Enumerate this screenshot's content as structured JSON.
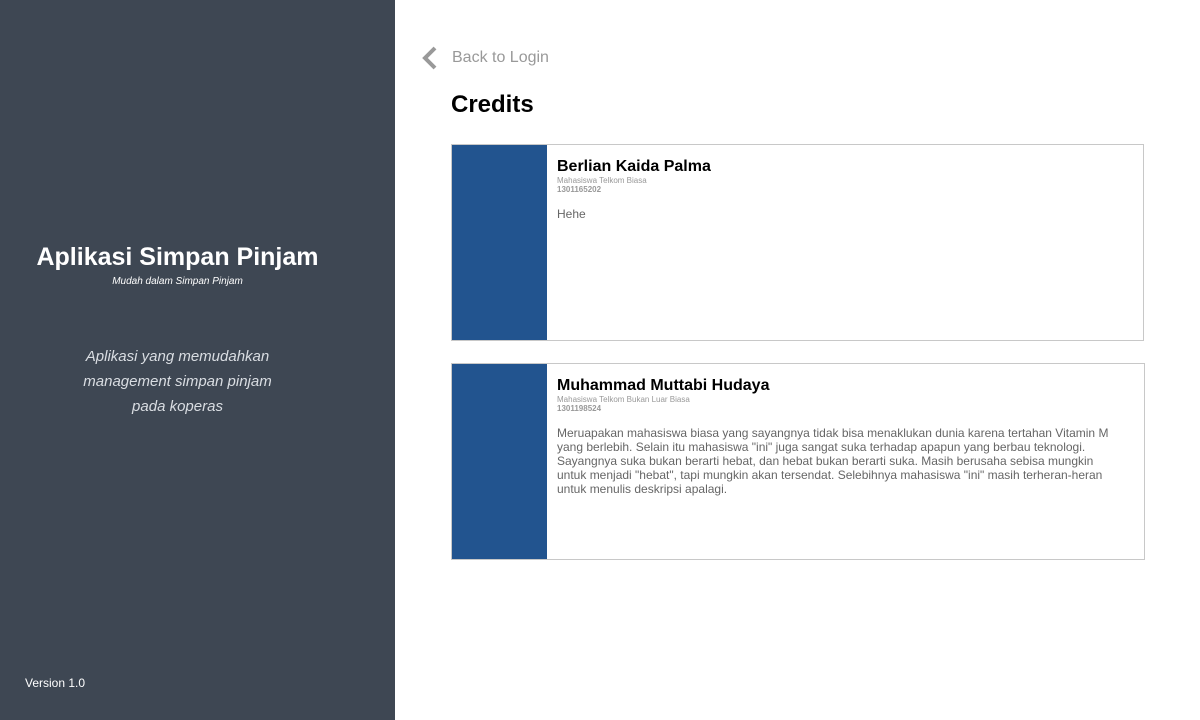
{
  "sidebar": {
    "title": "Aplikasi Simpan Pinjam",
    "subtitle": "Mudah dalam Simpan Pinjam",
    "description_lines": [
      "Aplikasi yang memudahkan",
      "management simpan pinjam",
      "pada koperas"
    ],
    "version": "Version 1.0",
    "background_color": "#3e4753"
  },
  "main": {
    "back_icon": "chevron-left-icon",
    "back_label": "Back to Login",
    "page_title": "Credits",
    "accent_color": "#22548f",
    "cards": [
      {
        "name": "Berlian Kaida Palma",
        "role": "Mahasiswa Telkom Biasa",
        "id": "1301165202",
        "description": "Hehe"
      },
      {
        "name": "Muhammad Muttabi Hudaya",
        "role": "Mahasiswa Telkom Bukan Luar Biasa",
        "id": "1301198524",
        "description": "Meruapakan mahasiswa biasa yang sayangnya tidak bisa menaklukan dunia karena tertahan Vitamin M yang berlebih. Selain itu mahasiswa \"ini\" juga sangat suka terhadap apapun yang berbau teknologi. Sayangnya suka bukan berarti hebat, dan hebat bukan berarti suka. Masih berusaha sebisa mungkin untuk menjadi \"hebat\", tapi mungkin akan tersendat. Selebihnya mahasiswa \"ini\" masih terheran-heran untuk menulis deskripsi apalagi."
      }
    ]
  }
}
